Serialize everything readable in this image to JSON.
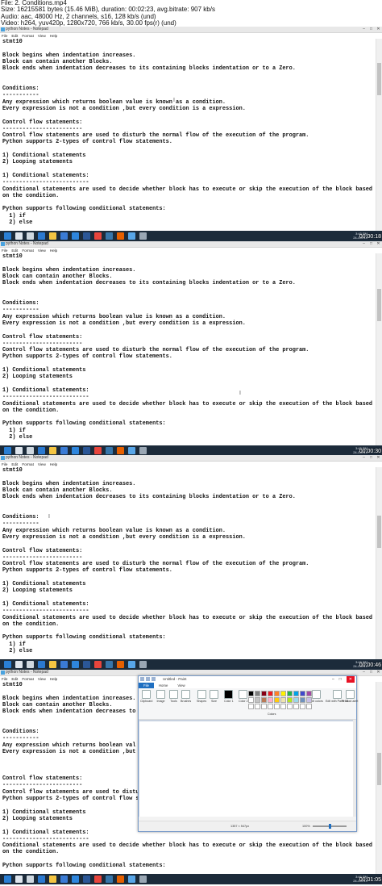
{
  "file_info": {
    "lines": [
      "File: 2. Conditions.mp4",
      "Size: 16215581 bytes (15.46 MiB), duration: 00:02:23, avg.bitrate: 907 kb/s",
      "Audio: aac, 48000 Hz, 2 channels, s16, 128 kb/s (und)",
      "Video: h264, yuv420p, 1280x720, 766 kb/s, 30.00 fps(r) (und)"
    ]
  },
  "notepad": {
    "title": "python Notes - Notepad",
    "menu": [
      "File",
      "Edit",
      "Format",
      "View",
      "Help"
    ],
    "window_controls": [
      "–",
      "□",
      "✕"
    ]
  },
  "document": {
    "lines": [
      "stmt10",
      "",
      "Block begins when indentation increases.",
      "Block can contain another Blocks.",
      "Block ends when indentation decreases to its containing blocks indentation or to a Zero.",
      "",
      "",
      "Conditions:",
      "-----------",
      "Any expression which returns boolean value is known as a condition.",
      "Every expression is not a condition ,but every condition is a expression.",
      "",
      "Control flow statements:",
      "------------------------",
      "Control flow statements are used to disturb the normal flow of the execution of the program.",
      "Python supports 2-types of control flow statements.",
      "",
      "1) Conditional statements",
      "2) Looping statements",
      "",
      "1) Conditional statements:",
      "--------------------------",
      "Conditional statements are used to decide whether block has to execute or skip the execution of the block based",
      "on the condition.",
      "",
      "Python supports following conditional statements:",
      "  1) if",
      "  2) else"
    ],
    "frame4_lines": [
      "stmt10",
      "",
      "Block begins when indentation increases.",
      "Block can contain another Blocks.",
      "Block ends when indentation decreases to",
      "",
      "",
      "Conditions:",
      "-----------",
      "Any expression which returns boolean val",
      "Every expression is not a condition ,but",
      "",
      "",
      "",
      "Control flow statements:",
      "------------------------",
      "Control flow statements are used to distu",
      "Python supports 2-types of control flow s",
      "",
      "1) Conditional statements",
      "2) Looping statements",
      "",
      "1) Conditional statements:",
      "--------------------------",
      "Conditional statements are used to decide whether block has to execute or skip the execution of the block based",
      "on the condition.",
      "",
      "Python supports following conditional statements:"
    ]
  },
  "frames": [
    {
      "clock": "3:45 PM",
      "date": "24-Oct-19",
      "stamp": "00:00:18"
    },
    {
      "clock": "3:45 PM",
      "date": "24-Oct-19",
      "stamp": "00:00:30"
    },
    {
      "clock": "3:45 PM",
      "date": "24-Oct-19",
      "stamp": "00:00:46"
    },
    {
      "clock": "3:46 PM",
      "date": "24-Oct-19",
      "stamp": "00:01:05"
    }
  ],
  "taskbar": {
    "icons": [
      "windows-start",
      "cortana-search",
      "task-view",
      "edge",
      "file-explorer",
      "store",
      "mail",
      "word",
      "chrome",
      "python",
      "firefox",
      "notepad",
      "settings"
    ]
  },
  "paint": {
    "title": "Untitled - Paint",
    "tabs": [
      "File",
      "Home",
      "View"
    ],
    "groups": [
      "Clipboard",
      "Image",
      "Tools",
      "Brushes",
      "Shapes",
      "Size",
      "Color 1",
      "Color 2",
      "Edit colors",
      "Edit with Paint 3D",
      "Product alert"
    ],
    "colors_label": "Colors",
    "dimensions": "1357 × 547px",
    "zoom": "100%",
    "palette": [
      "#000000",
      "#7f7f7f",
      "#880015",
      "#ed1c24",
      "#ff7f27",
      "#fff200",
      "#22b14c",
      "#00a2e8",
      "#3f48cc",
      "#a349a4",
      "#ffffff",
      "#c3c3c3",
      "#b97a57",
      "#ffaec9",
      "#ffc90e",
      "#efe4b0",
      "#b5e61d",
      "#99d9ea",
      "#7092be",
      "#c8bfe7",
      "#ffffff",
      "#ffffff",
      "#ffffff",
      "#ffffff",
      "#ffffff",
      "#ffffff",
      "#ffffff",
      "#ffffff",
      "#ffffff",
      "#ffffff"
    ]
  }
}
